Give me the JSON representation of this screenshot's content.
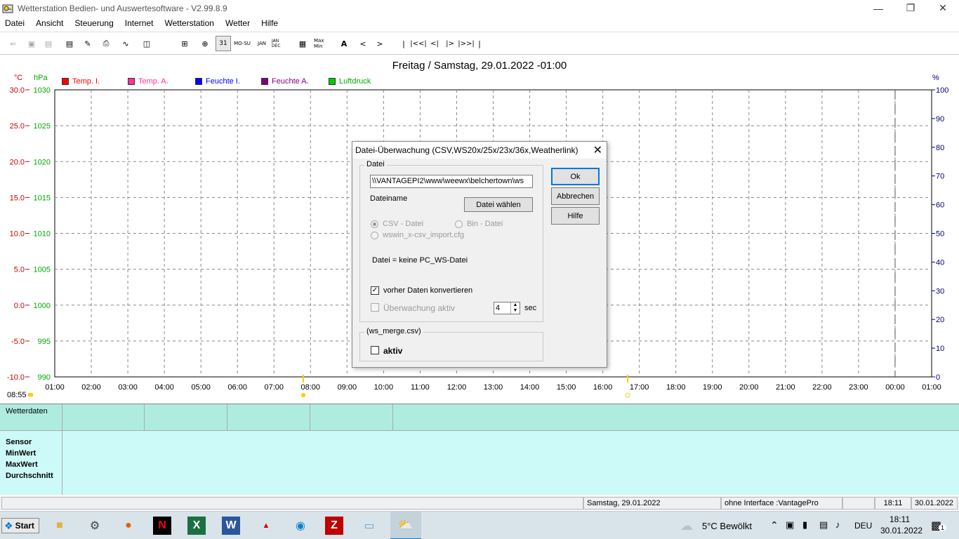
{
  "window": {
    "title": "Wetterstation Bedien- und Auswertesoftware - V2.99.8.9"
  },
  "menu": [
    {
      "label": "Datei"
    },
    {
      "label": "Ansicht"
    },
    {
      "label": "Steuerung"
    },
    {
      "label": "Internet"
    },
    {
      "label": "Wetterstation"
    },
    {
      "label": "Wetter"
    },
    {
      "label": "Hilfe"
    }
  ],
  "toolbar": {
    "mo_su": "MO-SU",
    "jan": "JAN",
    "jan_dec": "JAN DEC",
    "day31": "31",
    "font_a": "A",
    "nav_prev": "<",
    "nav_next": ">",
    "nav_first": "|",
    "nav_prev_big": "|<<|",
    "nav_prev_small": "<|",
    "nav_next_small": "|>",
    "nav_next_big": "|>>|",
    "nav_last": "|",
    "max_min": "Max Min"
  },
  "chart": {
    "title": "Freitag / Samstag, 29.01.2022  -01:00",
    "unit_c": "°C",
    "unit_hpa": "hPa",
    "unit_pct": "%",
    "start_time": "08:55",
    "legend": [
      {
        "label": "Temp. I.",
        "color": "#ff0000"
      },
      {
        "label": "Temp. A.",
        "color": "#ff3399"
      },
      {
        "label": "Feuchte I.",
        "color": "#0000ff"
      },
      {
        "label": "Feuchte A.",
        "color": "#800080"
      },
      {
        "label": "Luftdruck",
        "color": "#00cc00"
      }
    ],
    "colors": {
      "celsius": "#d00000",
      "hpa": "#00aa00",
      "percent": "#000080"
    }
  },
  "chart_data": {
    "type": "line",
    "title": "Freitag / Samstag, 29.01.2022  -01:00",
    "x_ticks": [
      "01:00",
      "02:00",
      "03:00",
      "04:00",
      "05:00",
      "06:00",
      "07:00",
      "08:00",
      "09:00",
      "10:00",
      "11:00",
      "12:00",
      "13:00",
      "14:00",
      "15:00",
      "16:00",
      "17:00",
      "18:00",
      "19:00",
      "20:00",
      "21:00",
      "22:00",
      "23:00",
      "00:00",
      "01:00"
    ],
    "y_left_celsius_ticks": [
      "30.0",
      "25.0",
      "20.0",
      "15.0",
      "10.0",
      "5.0",
      "0.0",
      "-5.0",
      "-10.0"
    ],
    "y_left_hpa_ticks": [
      "1030",
      "1025",
      "1020",
      "1015",
      "1010",
      "1005",
      "1000",
      "995",
      "990"
    ],
    "y_right_percent_ticks": [
      "100",
      "90",
      "80",
      "70",
      "60",
      "50",
      "40",
      "30",
      "20",
      "10",
      "0"
    ],
    "ylim_celsius": [
      -10,
      30
    ],
    "ylim_hpa": [
      990,
      1030
    ],
    "ylim_percent": [
      0,
      100
    ],
    "grid": true,
    "series": [
      {
        "name": "Temp. I.",
        "values": []
      },
      {
        "name": "Temp. A.",
        "values": []
      },
      {
        "name": "Feuchte I.",
        "values": []
      },
      {
        "name": "Feuchte A.",
        "values": []
      },
      {
        "name": "Luftdruck",
        "values": []
      }
    ]
  },
  "dialog": {
    "title": "Datei-Überwachung (CSV,WS20x/25x/23x/36x,Weatherlink)",
    "group_datei": "Datei",
    "path_value": "\\\\VANTAGEPI2\\www\\weewx\\belchertown\\ws",
    "dateiname_label": "Dateiname",
    "btn_choose": "Datei wählen",
    "radio_csv": "CSV - Datei",
    "radio_bin": "Bin - Datei",
    "radio_cfg": "wswin_x-csv_import.cfg",
    "info": "Datei  = keine PC_WS-Datei",
    "chk_convert": "vorher Daten konvertieren",
    "chk_monitor": "Überwachung aktiv",
    "interval_value": "4",
    "interval_unit": "sec",
    "group_merge": "(ws_merge.csv)",
    "chk_aktiv": "aktiv",
    "btn_ok": "Ok",
    "btn_cancel": "Abbrechen",
    "btn_help": "Hilfe"
  },
  "panel": {
    "head_label": "Wetterdaten",
    "rows": [
      "Sensor",
      "MinWert",
      "MaxWert",
      "Durchschnitt"
    ]
  },
  "status": {
    "date": "Samstag, 29.01.2022",
    "interface": "ohne Interface :VantagePro",
    "time": "18:11",
    "date2": "30.01.2022"
  },
  "taskbar": {
    "start": "Start",
    "weather": "5°C  Bewölkt",
    "lang": "DEU",
    "clock_time": "18:11",
    "clock_date": "30.01.2022",
    "notifications": "1"
  }
}
